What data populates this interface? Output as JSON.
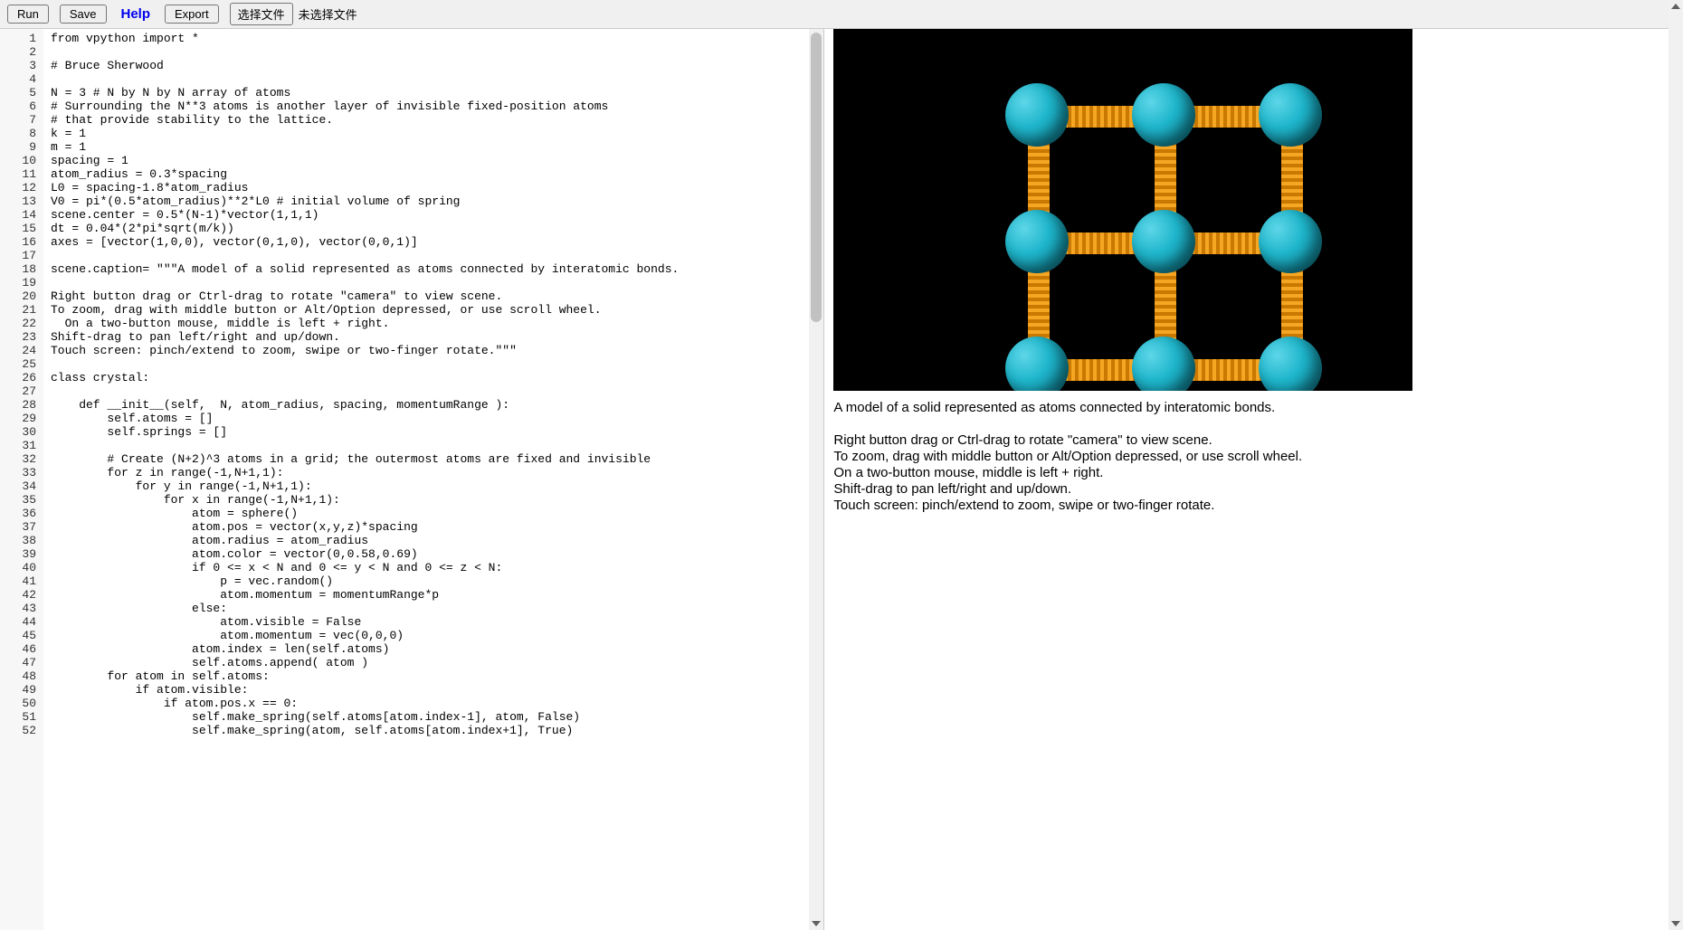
{
  "toolbar": {
    "run_label": "Run",
    "save_label": "Save",
    "help_label": "Help",
    "export_label": "Export",
    "choose_file_label": "选择文件",
    "file_status": "未选择文件"
  },
  "editor": {
    "lines": [
      "from vpython import *",
      "",
      "# Bruce Sherwood",
      "",
      "N = 3 # N by N by N array of atoms",
      "# Surrounding the N**3 atoms is another layer of invisible fixed-position atoms",
      "# that provide stability to the lattice.",
      "k = 1",
      "m = 1",
      "spacing = 1",
      "atom_radius = 0.3*spacing",
      "L0 = spacing-1.8*atom_radius",
      "V0 = pi*(0.5*atom_radius)**2*L0 # initial volume of spring",
      "scene.center = 0.5*(N-1)*vector(1,1,1)",
      "dt = 0.04*(2*pi*sqrt(m/k))",
      "axes = [vector(1,0,0), vector(0,1,0), vector(0,0,1)]",
      "",
      "scene.caption= \"\"\"A model of a solid represented as atoms connected by interatomic bonds.",
      "",
      "Right button drag or Ctrl-drag to rotate \"camera\" to view scene.",
      "To zoom, drag with middle button or Alt/Option depressed, or use scroll wheel.",
      "  On a two-button mouse, middle is left + right.",
      "Shift-drag to pan left/right and up/down.",
      "Touch screen: pinch/extend to zoom, swipe or two-finger rotate.\"\"\"",
      "",
      "class crystal:",
      "",
      "    def __init__(self,  N, atom_radius, spacing, momentumRange ):",
      "        self.atoms = []",
      "        self.springs = []",
      "",
      "        # Create (N+2)^3 atoms in a grid; the outermost atoms are fixed and invisible",
      "        for z in range(-1,N+1,1):",
      "            for y in range(-1,N+1,1):",
      "                for x in range(-1,N+1,1):",
      "                    atom = sphere()",
      "                    atom.pos = vector(x,y,z)*spacing",
      "                    atom.radius = atom_radius",
      "                    atom.color = vector(0,0.58,0.69)",
      "                    if 0 <= x < N and 0 <= y < N and 0 <= z < N:",
      "                        p = vec.random()",
      "                        atom.momentum = momentumRange*p",
      "                    else:",
      "                        atom.visible = False",
      "                        atom.momentum = vec(0,0,0)",
      "                    atom.index = len(self.atoms)",
      "                    self.atoms.append( atom )",
      "        for atom in self.atoms:",
      "            if atom.visible:",
      "                if atom.pos.x == 0:",
      "                    self.make_spring(self.atoms[atom.index-1], atom, False)",
      "                    self.make_spring(atom, self.atoms[atom.index+1], True)"
    ]
  },
  "caption": "A model of a solid represented as atoms connected by interatomic bonds.\n\nRight button drag or Ctrl-drag to rotate \"camera\" to view scene.\nTo zoom, drag with middle button or Alt/Option depressed, or use scroll wheel.\n  On a two-button mouse, middle is left + right.\nShift-drag to pan left/right and up/down.\nTouch screen: pinch/extend to zoom, swipe or two-finger rotate.",
  "viz": {
    "grid_n": 3,
    "atom_color": "#1fb6cc",
    "spring_color": "#f5a623"
  }
}
